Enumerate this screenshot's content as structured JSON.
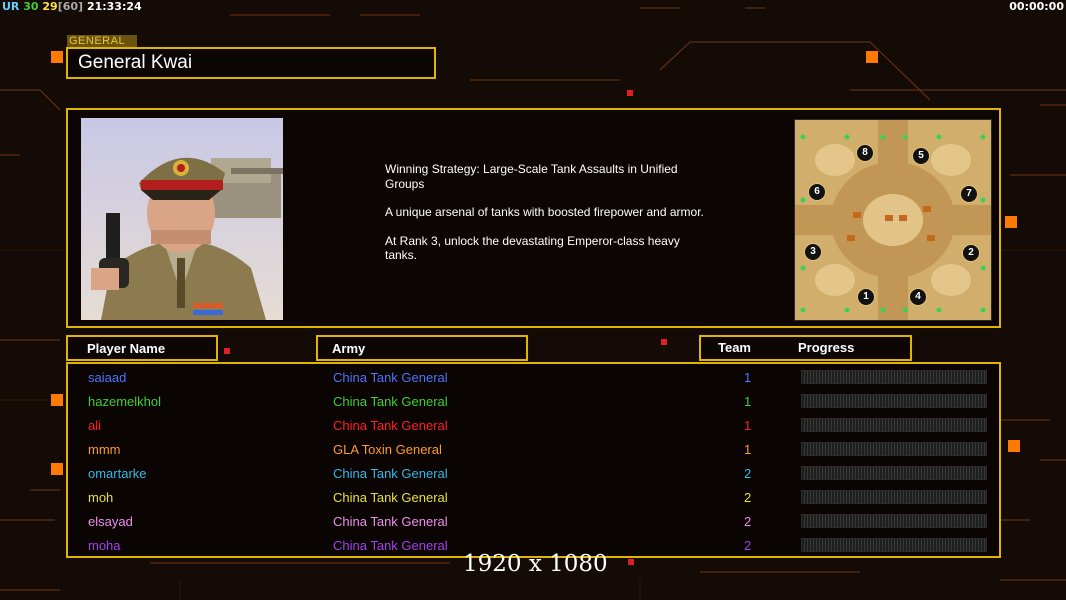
{
  "hud": {
    "ur_label": "UR",
    "ur_value1": "30",
    "ur_value2": "29",
    "ur_value3": "[60]",
    "clock": "21:33:24",
    "timer": "00:00:00"
  },
  "general": {
    "tag": "GENERAL",
    "name": "General Kwai",
    "description": [
      "Winning Strategy: Large-Scale Tank Assaults in Unified Groups",
      "A unique arsenal of tanks with boosted firepower and armor.",
      "At Rank 3, unlock the devastating Emperor-class heavy tanks."
    ]
  },
  "map": {
    "spawn_labels": [
      "8",
      "5",
      "6",
      "7",
      "3",
      "2",
      "1",
      "4"
    ]
  },
  "headers": {
    "player_name": "Player Name",
    "army": "Army",
    "team": "Team",
    "progress": "Progress"
  },
  "players": [
    {
      "name": "saiaad",
      "army": "China Tank General",
      "team": "1",
      "color": "#4f74ff"
    },
    {
      "name": "hazemelkhol",
      "army": "China Tank General",
      "team": "1",
      "color": "#3fd033"
    },
    {
      "name": "ali",
      "army": "China Tank General",
      "team": "1",
      "color": "#ff2020"
    },
    {
      "name": "mmm",
      "army": "GLA Toxin General",
      "team": "1",
      "color": "#ff9a2b"
    },
    {
      "name": "omartarke",
      "army": "China Tank General",
      "team": "2",
      "color": "#35b8e8"
    },
    {
      "name": "moh",
      "army": "China Tank General",
      "team": "2",
      "color": "#e6e23a"
    },
    {
      "name": "elsayad",
      "army": "China Tank General",
      "team": "2",
      "color": "#ee8eee"
    },
    {
      "name": "moha",
      "army": "China Tank General",
      "team": "2",
      "color": "#a040f0"
    }
  ],
  "watermark": "1920 x 1080",
  "colors": {
    "frame": "#e0b400",
    "background": "#140a06",
    "accent_orange": "#ff7a00"
  }
}
